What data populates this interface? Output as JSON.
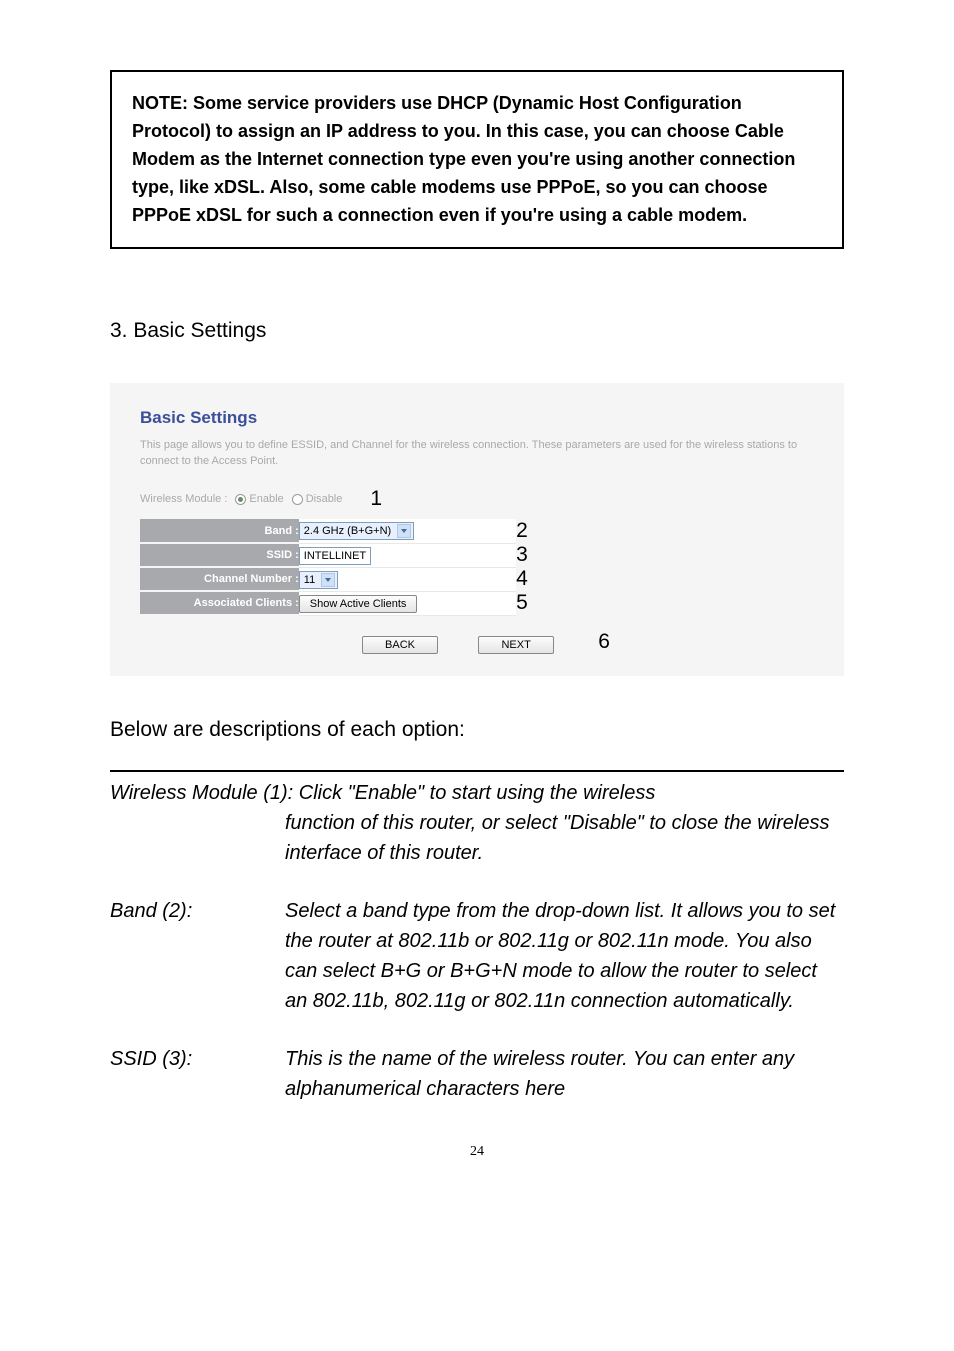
{
  "note": "NOTE: Some service providers use DHCP (Dynamic Host Configuration Protocol) to assign an IP address to you. In this case, you can choose Cable Modem as the Internet connection type even you're using another connection type, like xDSL. Also, some cable modems use PPPoE, so you can choose PPPoE xDSL for such a connection even if you're using a cable modem.",
  "section_heading": "3. Basic Settings",
  "panel": {
    "title": "Basic Settings",
    "desc": "This page allows you to define ESSID, and Channel for the wireless connection. These parameters are used for the wireless stations to connect to the Access Point.",
    "module_label": "Wireless Module :",
    "enable": "Enable",
    "disable": "Disable",
    "rows": {
      "band_label": "Band :",
      "band_value": "2.4 GHz (B+G+N)",
      "ssid_label": "SSID :",
      "ssid_value": "INTELLINET",
      "channel_label": "Channel Number :",
      "channel_value": "11",
      "assoc_label": "Associated Clients :",
      "assoc_button": "Show Active Clients"
    },
    "back": "BACK",
    "next": "NEXT",
    "annotations": {
      "a1": "1",
      "a2": "2",
      "a3": "3",
      "a4": "4",
      "a5": "5",
      "a6": "6"
    }
  },
  "below_intro": "Below are descriptions of each option:",
  "defs": {
    "wm_term": "Wireless Module (1): Click \"Enable\" to start using the wireless",
    "wm_body": "function of this router, or select \"Disable\" to close the wireless interface of this router.",
    "band_term": "Band (2):",
    "band_body": "Select a band type from the drop-down list. It allows you to set the router at 802.11b or 802.11g or 802.11n mode. You also can select B+G or B+G+N mode to allow the router to select an 802.11b, 802.11g or 802.11n connection automatically.",
    "ssid_term": "SSID (3):",
    "ssid_body": "This is the name of the wireless router. You can enter any alphanumerical characters here"
  },
  "page_num": "24"
}
